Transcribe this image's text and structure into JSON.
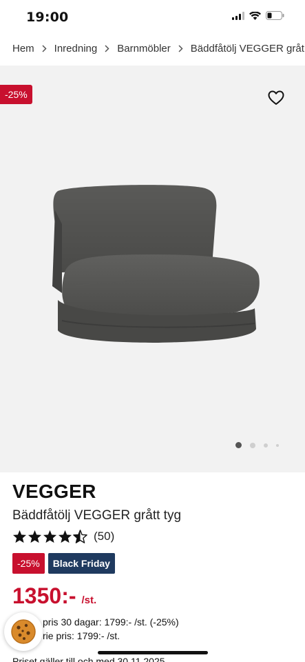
{
  "status": {
    "time": "19:00"
  },
  "breadcrumb": {
    "items": [
      "Hem",
      "Inredning",
      "Barnmöbler",
      "Bäddfåtölj VEGGER gråt"
    ]
  },
  "gallery": {
    "discount_tag": "-25%",
    "slides_total": 4,
    "active_slide": 1
  },
  "product": {
    "title": "VEGGER",
    "subtitle": "Bäddfåtölj VEGGER grått tyg",
    "rating": 4.5,
    "rating_count": "(50)",
    "badges": {
      "discount": "-25%",
      "campaign": "Black Friday"
    },
    "price": "1350:-",
    "price_unit": "/st.",
    "lowest_price_line": "pris 30 dagar: 1799:- /st. (-25%)",
    "ordinary_price_line": "rie pris: 1799:- /st.",
    "validity_note": "Priset gäller till och med 30.11.2025"
  },
  "colors": {
    "sale_red": "#c8102e",
    "campaign_navy": "#1f3a5f",
    "gallery_bg": "#f2f2f2"
  }
}
